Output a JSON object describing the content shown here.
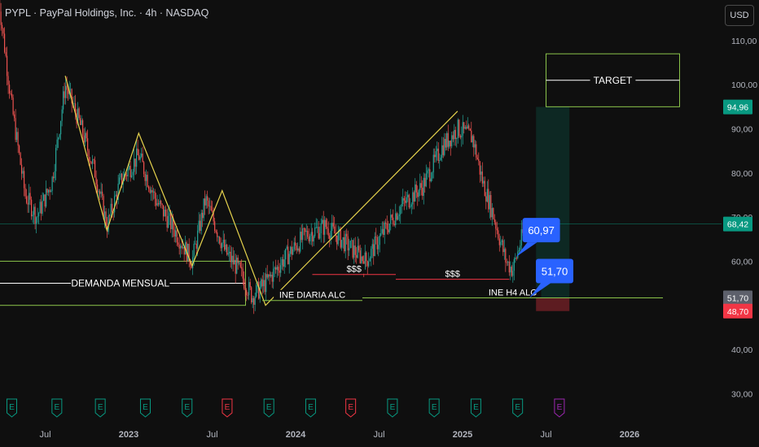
{
  "header": {
    "title": "PYPL · PayPal Holdings, Inc. · 4h · NASDAQ",
    "currency_button": "USD"
  },
  "chart_data": {
    "type": "candlestick",
    "symbol": "PYPL",
    "timeframe": "4h",
    "ylim": [
      30,
      120
    ],
    "y_ticks": [
      {
        "value": 30,
        "label": "30,00"
      },
      {
        "value": 40,
        "label": "40,00"
      },
      {
        "value": 50,
        "label": "50,00"
      },
      {
        "value": 60,
        "label": "60,00"
      },
      {
        "value": 70,
        "label": "70,00"
      },
      {
        "value": 80,
        "label": "80,00"
      },
      {
        "value": 90,
        "label": "90,00"
      },
      {
        "value": 100,
        "label": "100,00"
      },
      {
        "value": 110,
        "label": "110,00"
      }
    ],
    "x_ticks": [
      "Jul",
      "2023",
      "Jul",
      "2024",
      "Jul",
      "2025",
      "Jul",
      "2026"
    ],
    "x_tick_times": [
      2022.5,
      2023.0,
      2023.5,
      2024.0,
      2024.5,
      2025.0,
      2025.5,
      2026.0
    ],
    "price_path": [
      {
        "t": 2022.22,
        "p": 120
      },
      {
        "t": 2022.3,
        "p": 95
      },
      {
        "t": 2022.38,
        "p": 75
      },
      {
        "t": 2022.45,
        "p": 70
      },
      {
        "t": 2022.54,
        "p": 78
      },
      {
        "t": 2022.62,
        "p": 100
      },
      {
        "t": 2022.7,
        "p": 92
      },
      {
        "t": 2022.8,
        "p": 80
      },
      {
        "t": 2022.87,
        "p": 68
      },
      {
        "t": 2022.95,
        "p": 78
      },
      {
        "t": 2023.06,
        "p": 84
      },
      {
        "t": 2023.16,
        "p": 74
      },
      {
        "t": 2023.26,
        "p": 68
      },
      {
        "t": 2023.38,
        "p": 60
      },
      {
        "t": 2023.46,
        "p": 74
      },
      {
        "t": 2023.58,
        "p": 62
      },
      {
        "t": 2023.66,
        "p": 58
      },
      {
        "t": 2023.74,
        "p": 52
      },
      {
        "t": 2023.82,
        "p": 55
      },
      {
        "t": 2023.92,
        "p": 60
      },
      {
        "t": 2024.06,
        "p": 66
      },
      {
        "t": 2024.18,
        "p": 68
      },
      {
        "t": 2024.3,
        "p": 64
      },
      {
        "t": 2024.42,
        "p": 60
      },
      {
        "t": 2024.5,
        "p": 65
      },
      {
        "t": 2024.62,
        "p": 72
      },
      {
        "t": 2024.76,
        "p": 77
      },
      {
        "t": 2024.88,
        "p": 86
      },
      {
        "t": 2024.97,
        "p": 90
      },
      {
        "t": 2025.06,
        "p": 88
      },
      {
        "t": 2025.12,
        "p": 78
      },
      {
        "t": 2025.18,
        "p": 71
      },
      {
        "t": 2025.26,
        "p": 60
      },
      {
        "t": 2025.3,
        "p": 58
      },
      {
        "t": 2025.36,
        "p": 66
      }
    ],
    "current_price": {
      "value": 68.42,
      "label": "68,42"
    },
    "price_tags": [
      {
        "value": 94.96,
        "label": "94,96",
        "color": "#089981"
      },
      {
        "value": 68.42,
        "label": "68,42",
        "color": "#089981"
      },
      {
        "value": 51.7,
        "label": "51,70",
        "color": "#5d606b"
      },
      {
        "value": 48.7,
        "label": "48,70",
        "color": "#f23645"
      }
    ],
    "callouts": [
      {
        "label": "60,97",
        "value": 60.97,
        "t": 2025.32
      },
      {
        "label": "51,70",
        "value": 51.7,
        "t": 2025.4
      }
    ],
    "zigzag_lines": [
      {
        "color": "#e6d34d",
        "points": [
          {
            "t": 2022.62,
            "p": 102
          },
          {
            "t": 2022.87,
            "p": 67
          },
          {
            "t": 2023.06,
            "p": 89
          },
          {
            "t": 2023.38,
            "p": 59
          },
          {
            "t": 2023.56,
            "p": 76
          },
          {
            "t": 2023.82,
            "p": 50
          },
          {
            "t": 2024.97,
            "p": 94
          }
        ]
      }
    ],
    "zones": [
      {
        "label": "DEMANDA MENSUAL",
        "t0": 2022.2,
        "t1": 2023.7,
        "p0": 50,
        "p1": 60,
        "color": "#8bc34a"
      },
      {
        "label": "TARGET",
        "t0": 2025.5,
        "t1": 2026.3,
        "p0": 95,
        "p1": 107,
        "color": "#8bc34a"
      }
    ],
    "position": {
      "entry": 51.7,
      "target": 94.96,
      "stop": 48.7,
      "t0": 2025.44,
      "t1": 2025.64
    },
    "level_lines": [
      {
        "label": "INE DIARIA ALC",
        "value": 51.1,
        "t0": 2023.8,
        "t1": 2024.4,
        "color": "#8bc34a"
      },
      {
        "label": "INE H4 ALC",
        "value": 51.7,
        "t0": 2024.4,
        "t1": 2026.2,
        "color": "#8bc34a"
      },
      {
        "label": "$$$",
        "value": 57.0,
        "t0": 2024.1,
        "t1": 2024.6,
        "color": "#f23645"
      },
      {
        "label": "$$$",
        "value": 55.9,
        "t0": 2024.6,
        "t1": 2025.28,
        "color": "#f23645"
      }
    ],
    "earnings_markers": [
      {
        "t": 2022.3,
        "label": "E",
        "color": "#089981"
      },
      {
        "t": 2022.57,
        "label": "E",
        "color": "#089981"
      },
      {
        "t": 2022.83,
        "label": "E",
        "color": "#089981"
      },
      {
        "t": 2023.1,
        "label": "E",
        "color": "#089981"
      },
      {
        "t": 2023.35,
        "label": "E",
        "color": "#089981"
      },
      {
        "t": 2023.59,
        "label": "E",
        "color": "#f23645"
      },
      {
        "t": 2023.84,
        "label": "E",
        "color": "#089981"
      },
      {
        "t": 2024.09,
        "label": "E",
        "color": "#089981"
      },
      {
        "t": 2024.33,
        "label": "E",
        "color": "#f23645"
      },
      {
        "t": 2024.58,
        "label": "E",
        "color": "#089981"
      },
      {
        "t": 2024.83,
        "label": "E",
        "color": "#089981"
      },
      {
        "t": 2025.08,
        "label": "E",
        "color": "#089981"
      },
      {
        "t": 2025.33,
        "label": "E",
        "color": "#089981"
      },
      {
        "t": 2025.58,
        "label": "E",
        "color": "#9c27b0"
      }
    ]
  }
}
